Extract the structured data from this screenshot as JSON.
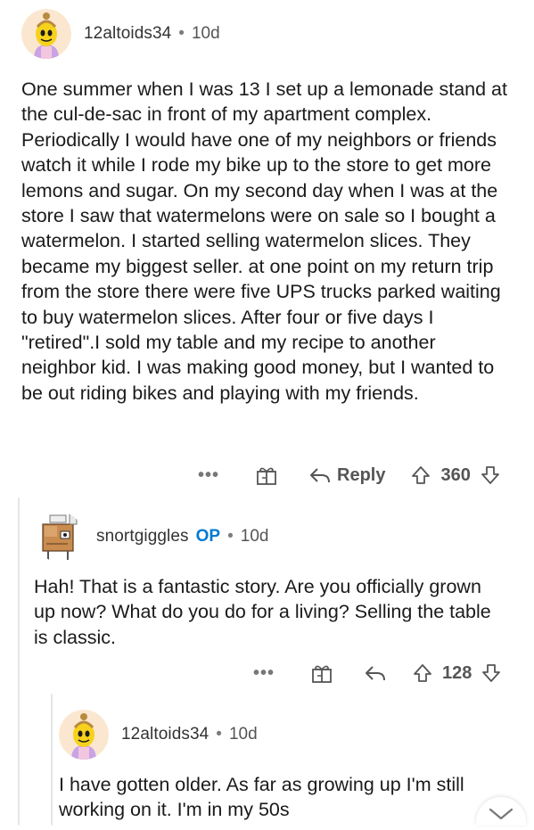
{
  "comments": [
    {
      "username": "12altoids34",
      "separator": "•",
      "age": "10d",
      "body": "One summer when I was 13 I set up a lemonade stand at the cul-de-sac in front of my apartment complex. Periodically I would have one of my neighbors or friends watch it while I rode my bike up to the store to get more lemons and sugar. On my second day when I was at the store I saw that watermelons were on sale so I bought a watermelon. I started selling watermelon slices. They became my biggest seller. at one point on my return trip from the store there were five UPS trucks parked waiting to buy watermelon slices. After four or five days I \"retired\".I sold my table and my recipe to another neighbor kid. I was making good money, but I wanted to be out riding bikes and playing with my friends.",
      "more_label": "•••",
      "reply_label": "Reply",
      "score": "360"
    },
    {
      "username": "snortgiggles",
      "badge": "OP",
      "separator": "•",
      "age": "10d",
      "body": "Hah! That is a fantastic story. Are you officially grown up now? What do you do for a living? Selling the table is classic.",
      "more_label": "•••",
      "score": "128"
    },
    {
      "username": "12altoids34",
      "separator": "•",
      "age": "10d",
      "body": "I have gotten older. As far as growing up I'm still working on it. I'm in my 50s"
    }
  ],
  "colors": {
    "op_badge": "#0079d3",
    "thread_line": "#e4e6e8"
  }
}
